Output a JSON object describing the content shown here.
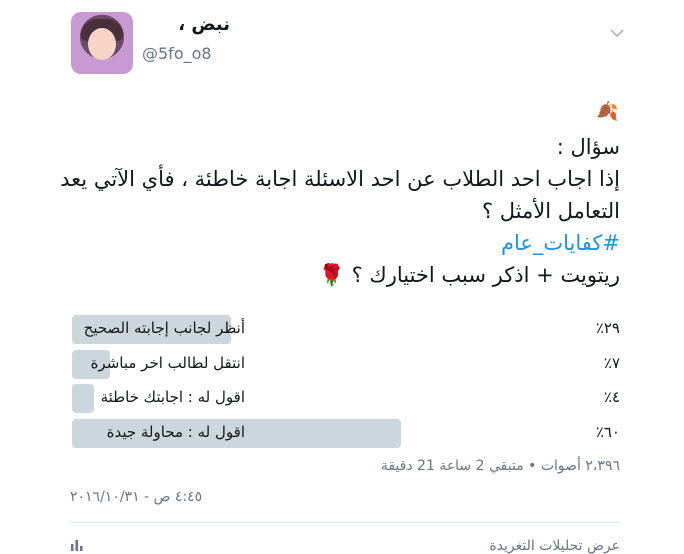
{
  "user": {
    "display_name": "نبض ،",
    "handle": "@5fo_o8"
  },
  "tweet": {
    "lines": [
      "سؤال :",
      "إذا اجاب احد الطلاب عن احد الاسئلة اجابة خاطئة ، فأي الآتي يعد",
      "التعامل الأمثل ؟",
      "#كفايات_عام",
      "ريتويت + اذكر سبب اختيارك ؟ 🌹"
    ]
  },
  "poll": {
    "options": [
      {
        "label": "أنظر لجانب إجابته الصحيح",
        "percent_text": "٢٩٪",
        "fraction": 0.29
      },
      {
        "label": "انتقل لطالب اخر مباشرة",
        "percent_text": "٧٪",
        "fraction": 0.07
      },
      {
        "label": "اقول له : اجابتك خاطئة",
        "percent_text": "٤٪",
        "fraction": 0.04
      },
      {
        "label": "اقول له : محاولة جيدة",
        "percent_text": "٦٠٪",
        "fraction": 0.6
      }
    ],
    "meta": "٢،٣٩٦ أصوات • متبقي 2 ساعة 21 دقيقة"
  },
  "timestamp": "٤:٤٥ ص - ٢٠١٦/١٠/٣١",
  "analytics_label": "عرض تحليلات التغريدة",
  "icons": {
    "leaf": "🍂",
    "chevron": "chevron-down-icon",
    "analytics": "bar-chart-icon"
  },
  "colors": {
    "text": "#14171a",
    "muted": "#657786",
    "link": "#1b95e0",
    "poll_bar": "#ccd6dd"
  }
}
